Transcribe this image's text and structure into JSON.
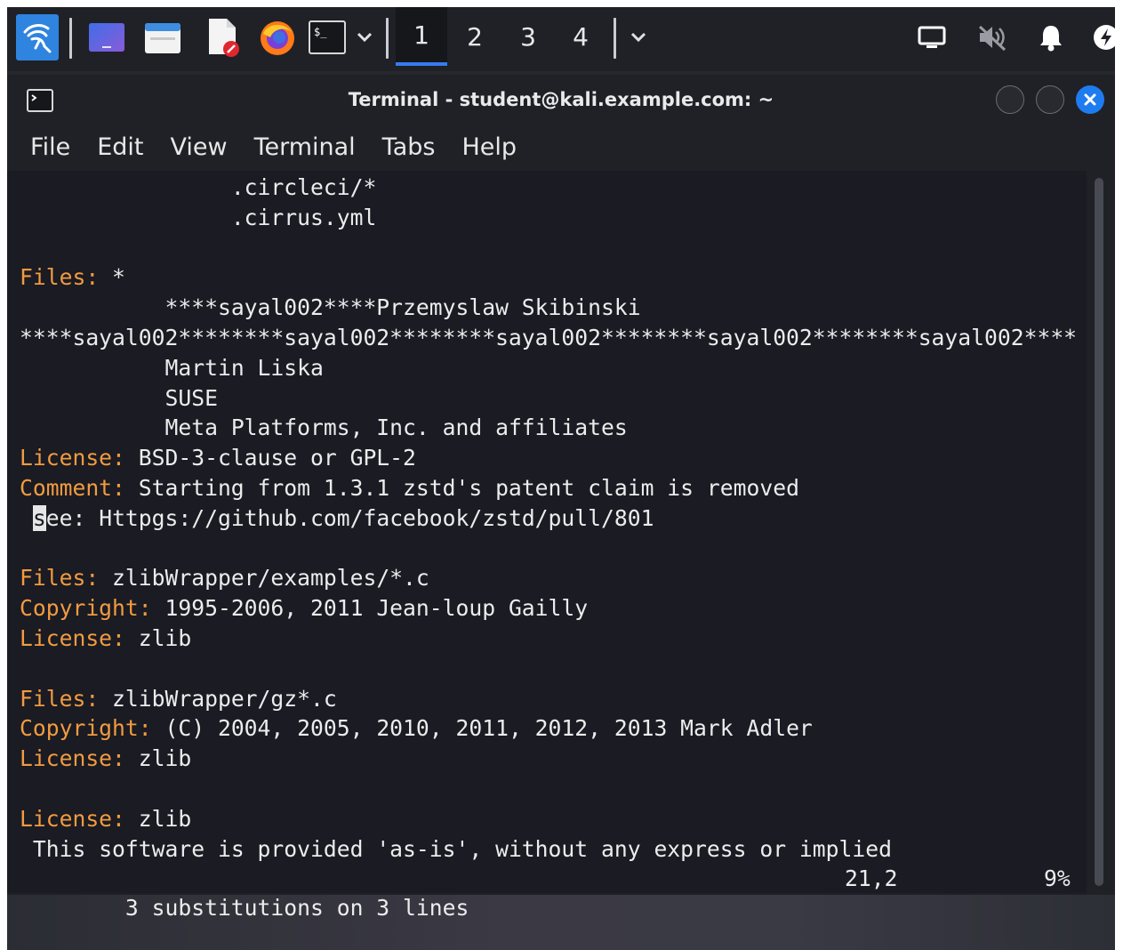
{
  "panel": {
    "workspaces": [
      "1",
      "2",
      "3",
      "4"
    ],
    "active_workspace": "1",
    "launchers": [
      "kali-menu-icon",
      "desktop-icon",
      "file-manager-icon",
      "text-editor-icon",
      "firefox-icon",
      "terminal-icon"
    ],
    "tray": [
      "display-icon",
      "volume-muted-icon",
      "notification-bell-icon",
      "power-icon"
    ]
  },
  "window": {
    "title": "Terminal - student@kali.example.com: ~",
    "menu": [
      "File",
      "Edit",
      "View",
      "Terminal",
      "Tabs",
      "Help"
    ]
  },
  "terminal": {
    "lines": [
      {
        "indent": "          ",
        "key": "",
        "text": "      .circleci/*"
      },
      {
        "indent": "          ",
        "key": "",
        "text": "      .cirrus.yml"
      },
      {
        "indent": "",
        "key": "",
        "text": ""
      },
      {
        "indent": "",
        "key": "Files:",
        "text": " *"
      },
      {
        "indent": "           ",
        "key": "",
        "text": "****sayal002****Przemyslaw Skibinski"
      },
      {
        "indent": "",
        "key": "",
        "text": "****sayal002********sayal002********sayal002********sayal002********sayal002****"
      },
      {
        "indent": "           ",
        "key": "",
        "text": "Martin Liska"
      },
      {
        "indent": "           ",
        "key": "",
        "text": "SUSE"
      },
      {
        "indent": "           ",
        "key": "",
        "text": "Meta Platforms, Inc. and affiliates"
      },
      {
        "indent": "",
        "key": "License:",
        "text": " BSD-3-clause or GPL-2"
      },
      {
        "indent": "",
        "key": "Comment:",
        "text": " Starting from 1.3.1 zstd's patent claim is removed"
      },
      {
        "indent": " ",
        "key": "",
        "cursor": "s",
        "text": "ee: Httpgs://github.com/facebook/zstd/pull/801"
      },
      {
        "indent": "",
        "key": "",
        "text": ""
      },
      {
        "indent": "",
        "key": "Files:",
        "text": " zlibWrapper/examples/*.c"
      },
      {
        "indent": "",
        "key": "Copyright:",
        "text": " 1995-2006, 2011 Jean-loup Gailly"
      },
      {
        "indent": "",
        "key": "License:",
        "text": " zlib"
      },
      {
        "indent": "",
        "key": "",
        "text": ""
      },
      {
        "indent": "",
        "key": "Files:",
        "text": " zlibWrapper/gz*.c"
      },
      {
        "indent": "",
        "key": "Copyright:",
        "text": " (C) 2004, 2005, 2010, 2011, 2012, 2013 Mark Adler"
      },
      {
        "indent": "",
        "key": "License:",
        "text": " zlib"
      },
      {
        "indent": "",
        "key": "",
        "text": ""
      },
      {
        "indent": "",
        "key": "License:",
        "text": " zlib"
      },
      {
        "indent": " ",
        "key": "",
        "text": "This software is provided 'as-is', without any express or implied"
      }
    ],
    "status": {
      "message": "3 substitutions on 3 lines",
      "position": "21,2",
      "percent": "9%"
    }
  },
  "colors": {
    "key": "#f29b40",
    "text": "#ececec",
    "background": "#1a1b23",
    "accent": "#367bf0"
  }
}
